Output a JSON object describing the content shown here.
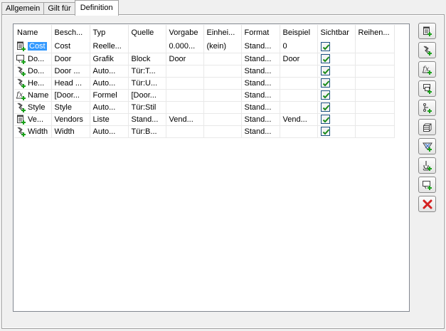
{
  "tabs": [
    "Allgemein",
    "Gilt für",
    "Definition"
  ],
  "active_tab": "Definition",
  "table": {
    "columns": [
      "Name",
      "Besch...",
      "Typ",
      "Quelle",
      "Vorgabe",
      "Einhei...",
      "Format",
      "Beispiel",
      "Sichtbar",
      "Reihen..."
    ],
    "rows": [
      {
        "icon": "list-property-icon",
        "name": "Cost",
        "desc": "Cost",
        "type": "Reelle...",
        "source": "",
        "default": "0.000...",
        "unit": "(kein)",
        "format": "Stand...",
        "example": "0",
        "visible": true,
        "order": "",
        "selected": true
      },
      {
        "icon": "graphic-property-icon",
        "name": "Do...",
        "desc": "Door",
        "type": "Grafik",
        "source": "Block",
        "default": "Door",
        "unit": "",
        "format": "Stand...",
        "example": "Door",
        "visible": true,
        "order": ""
      },
      {
        "icon": "auto-property-icon",
        "name": "Do...",
        "desc": "Door ...",
        "type": "Auto...",
        "source": "Tür:T...",
        "default": "",
        "unit": "",
        "format": "Stand...",
        "example": "",
        "visible": true,
        "order": ""
      },
      {
        "icon": "auto-property-icon",
        "name": "He...",
        "desc": "Head ...",
        "type": "Auto...",
        "source": "Tür:U...",
        "default": "",
        "unit": "",
        "format": "Stand...",
        "example": "",
        "visible": true,
        "order": ""
      },
      {
        "icon": "formula-property-icon",
        "name": "Name",
        "desc": "[Door...",
        "type": "Formel",
        "source": "[Door...",
        "default": "",
        "unit": "",
        "format": "Stand...",
        "example": "",
        "visible": true,
        "order": ""
      },
      {
        "icon": "auto-property-icon",
        "name": "Style",
        "desc": "Style",
        "type": "Auto...",
        "source": "Tür:Stil",
        "default": "",
        "unit": "",
        "format": "Stand...",
        "example": "",
        "visible": true,
        "order": ""
      },
      {
        "icon": "list-property-icon",
        "name": "Ve...",
        "desc": "Vendors",
        "type": "Liste",
        "source": "Stand...",
        "default": "Vend...",
        "unit": "",
        "format": "Stand...",
        "example": "Vend...",
        "visible": true,
        "order": ""
      },
      {
        "icon": "auto-property-icon",
        "name": "Width",
        "desc": "Width",
        "type": "Auto...",
        "source": "Tür:B...",
        "default": "",
        "unit": "",
        "format": "Stand...",
        "example": "",
        "visible": true,
        "order": ""
      }
    ]
  },
  "side_buttons": [
    {
      "name": "add-manual-property-button",
      "icon": "add-manual-property-icon"
    },
    {
      "name": "add-auto-property-button",
      "icon": "add-auto-property-icon"
    },
    {
      "name": "add-formula-property-button",
      "icon": "add-formula-property-icon"
    },
    {
      "name": "add-location-property-button",
      "icon": "add-location-property-icon"
    },
    {
      "name": "add-classification-property-button",
      "icon": "add-classification-property-icon"
    },
    {
      "name": "add-material-property-button",
      "icon": "add-material-property-icon"
    },
    {
      "name": "add-anchor-property-button",
      "icon": "add-anchor-property-icon"
    },
    {
      "name": "add-anchor-position-property-button",
      "icon": "add-anchor-position-property-icon"
    },
    {
      "name": "add-graphic-property-button",
      "icon": "add-graphic-property-icon"
    },
    {
      "name": "delete-property-button",
      "icon": "delete-red-x-icon"
    }
  ],
  "colors": {
    "selection": "#3399ff",
    "check": "#1a8a1a",
    "delete": "#d42020",
    "plus": "#1aa01a"
  }
}
